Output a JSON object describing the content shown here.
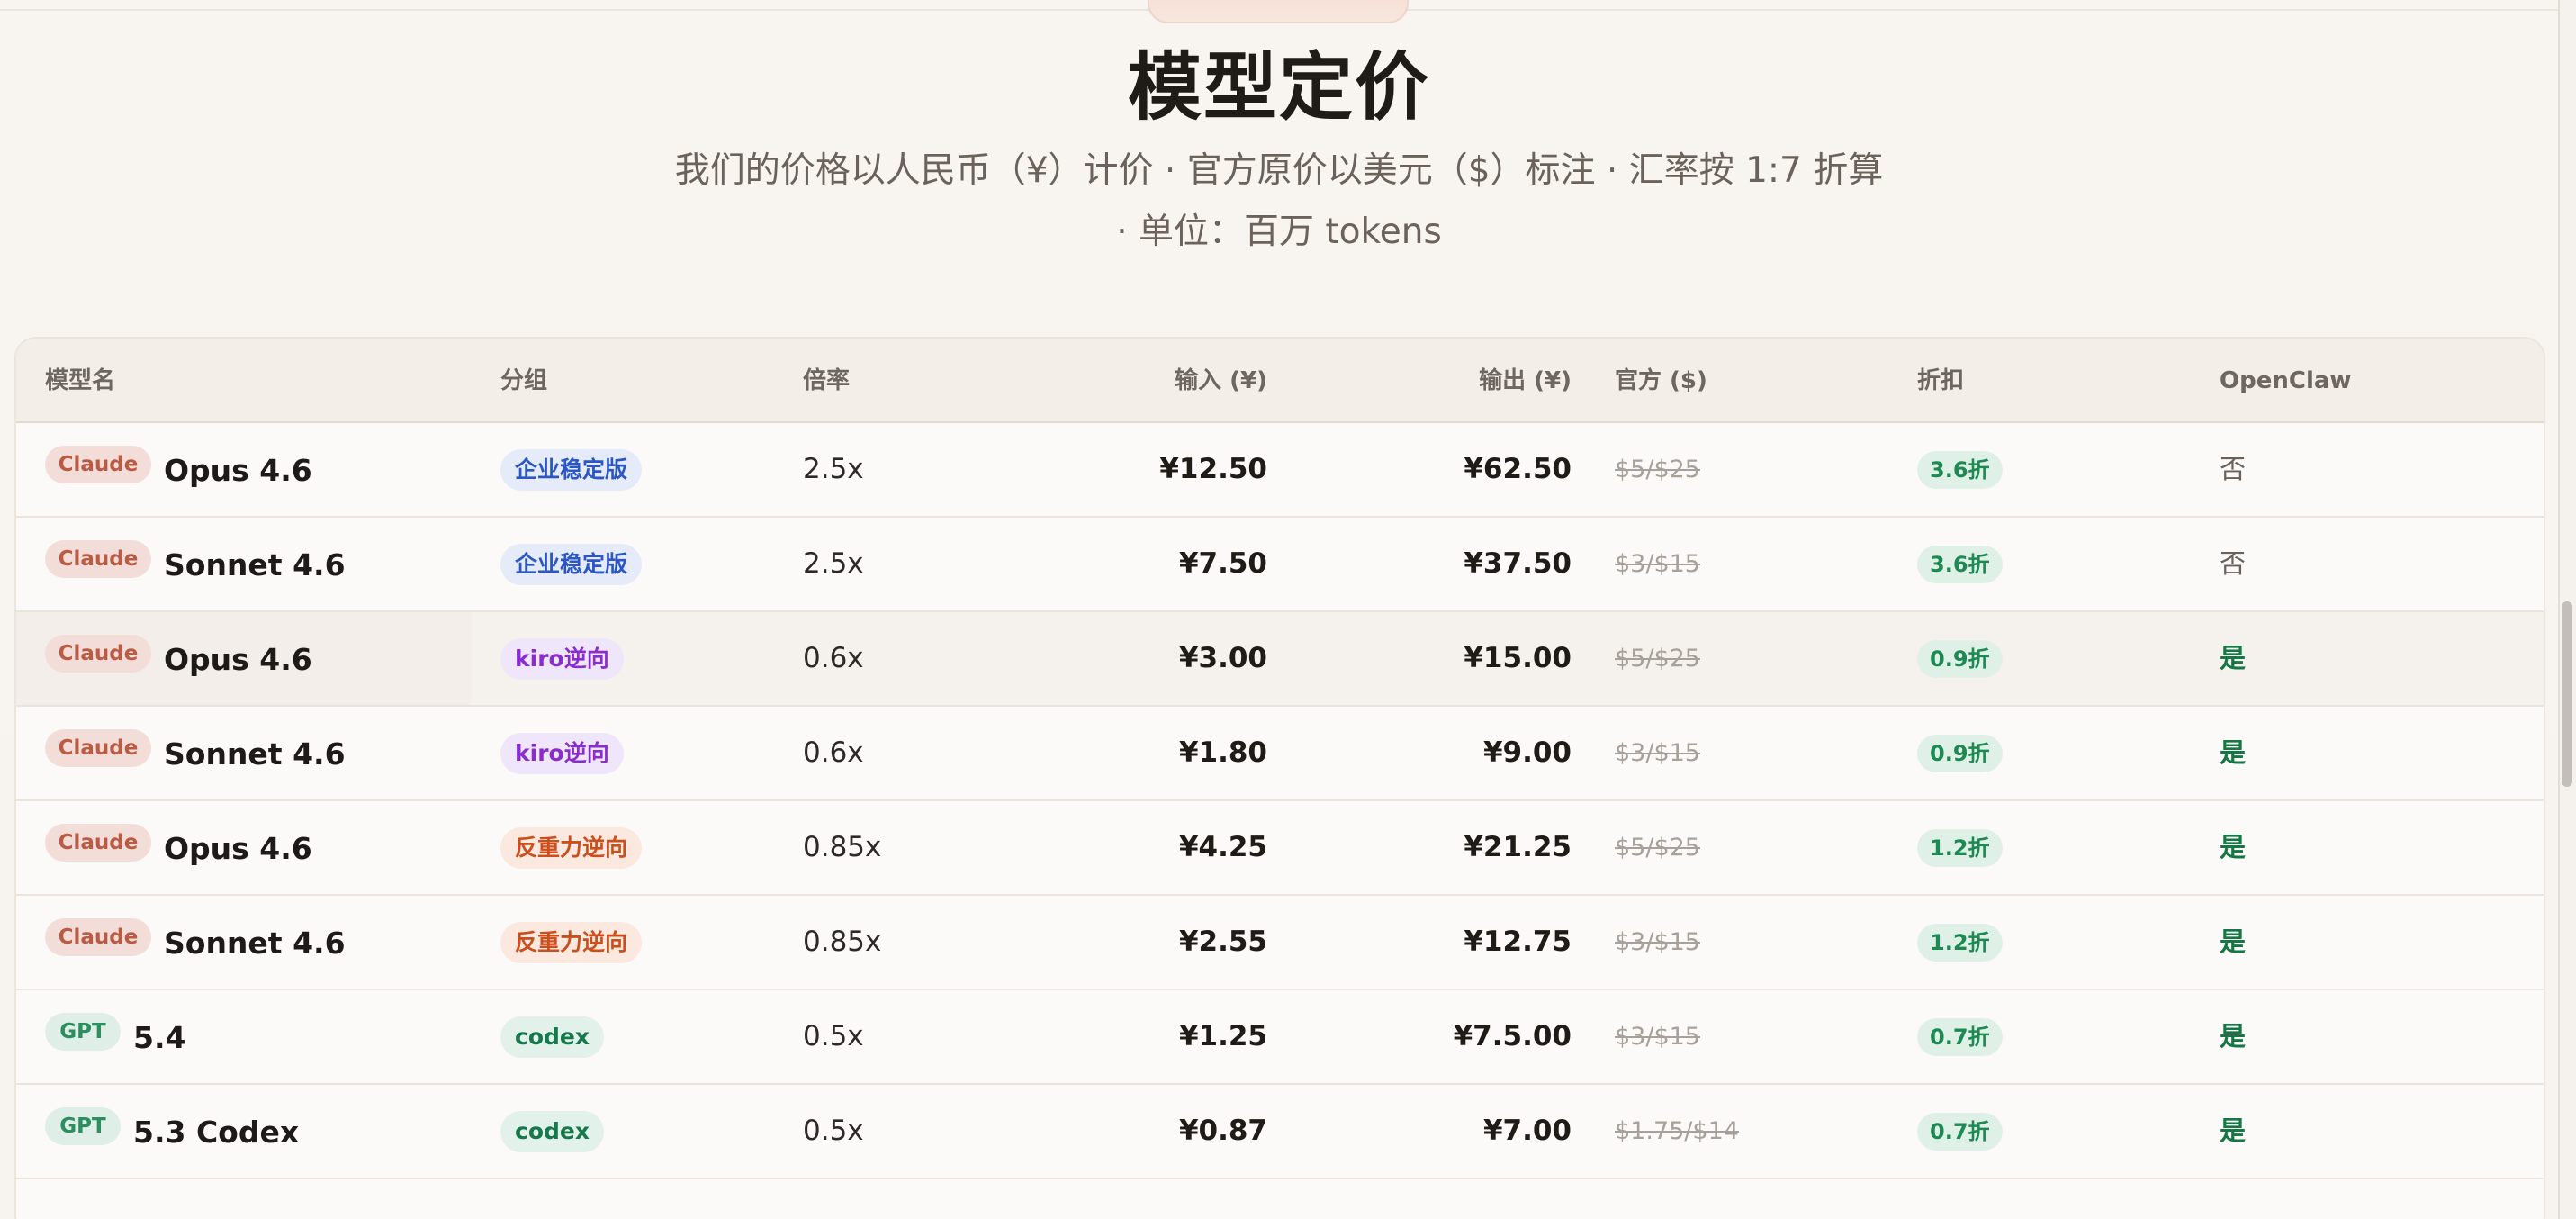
{
  "page": {
    "title": "模型定价",
    "subtitle_line1": "我们的价格以人民币（¥）计价 · 官方原价以美元（$）标注 · 汇率按 1:7 折算",
    "subtitle_line2": "· 单位：百万 tokens"
  },
  "table": {
    "headers": {
      "model": "模型名",
      "group": "分组",
      "ratio": "倍率",
      "input": "输入 (¥)",
      "output": "输出 (¥)",
      "official": "官方 ($)",
      "discount": "折扣",
      "openclaw": "OpenClaw"
    },
    "rows": [
      {
        "provider": "Claude",
        "model": "Opus 4.6",
        "group": "企业稳定版",
        "ratio": "2.5x",
        "input": "¥12.50",
        "output": "¥62.50",
        "official": "$5/$25",
        "discount": "3.6折",
        "openclaw": "否"
      },
      {
        "provider": "Claude",
        "model": "Sonnet 4.6",
        "group": "企业稳定版",
        "ratio": "2.5x",
        "input": "¥7.50",
        "output": "¥37.50",
        "official": "$3/$15",
        "discount": "3.6折",
        "openclaw": "否"
      },
      {
        "provider": "Claude",
        "model": "Opus 4.6",
        "group": "kiro逆向",
        "ratio": "0.6x",
        "input": "¥3.00",
        "output": "¥15.00",
        "official": "$5/$25",
        "discount": "0.9折",
        "openclaw": "是"
      },
      {
        "provider": "Claude",
        "model": "Sonnet 4.6",
        "group": "kiro逆向",
        "ratio": "0.6x",
        "input": "¥1.80",
        "output": "¥9.00",
        "official": "$3/$15",
        "discount": "0.9折",
        "openclaw": "是"
      },
      {
        "provider": "Claude",
        "model": "Opus 4.6",
        "group": "反重力逆向",
        "ratio": "0.85x",
        "input": "¥4.25",
        "output": "¥21.25",
        "official": "$5/$25",
        "discount": "1.2折",
        "openclaw": "是"
      },
      {
        "provider": "Claude",
        "model": "Sonnet 4.6",
        "group": "反重力逆向",
        "ratio": "0.85x",
        "input": "¥2.55",
        "output": "¥12.75",
        "official": "$3/$15",
        "discount": "1.2折",
        "openclaw": "是"
      },
      {
        "provider": "GPT",
        "model": "5.4",
        "group": "codex",
        "ratio": "0.5x",
        "input": "¥1.25",
        "output": "¥7.5.00",
        "official": "$3/$15",
        "discount": "0.7折",
        "openclaw": "是"
      },
      {
        "provider": "GPT",
        "model": "5.3 Codex",
        "group": "codex",
        "ratio": "0.5x",
        "input": "¥0.87",
        "output": "¥7.00",
        "official": "$1.75/$14",
        "discount": "0.7折",
        "openclaw": "是"
      }
    ]
  },
  "colors": {
    "background": "#f7f3ef",
    "claude_badge": "#f3ddd8",
    "gpt_badge": "#dfeee6",
    "discount_badge": "#dff1e7",
    "yes_text": "#157744"
  }
}
